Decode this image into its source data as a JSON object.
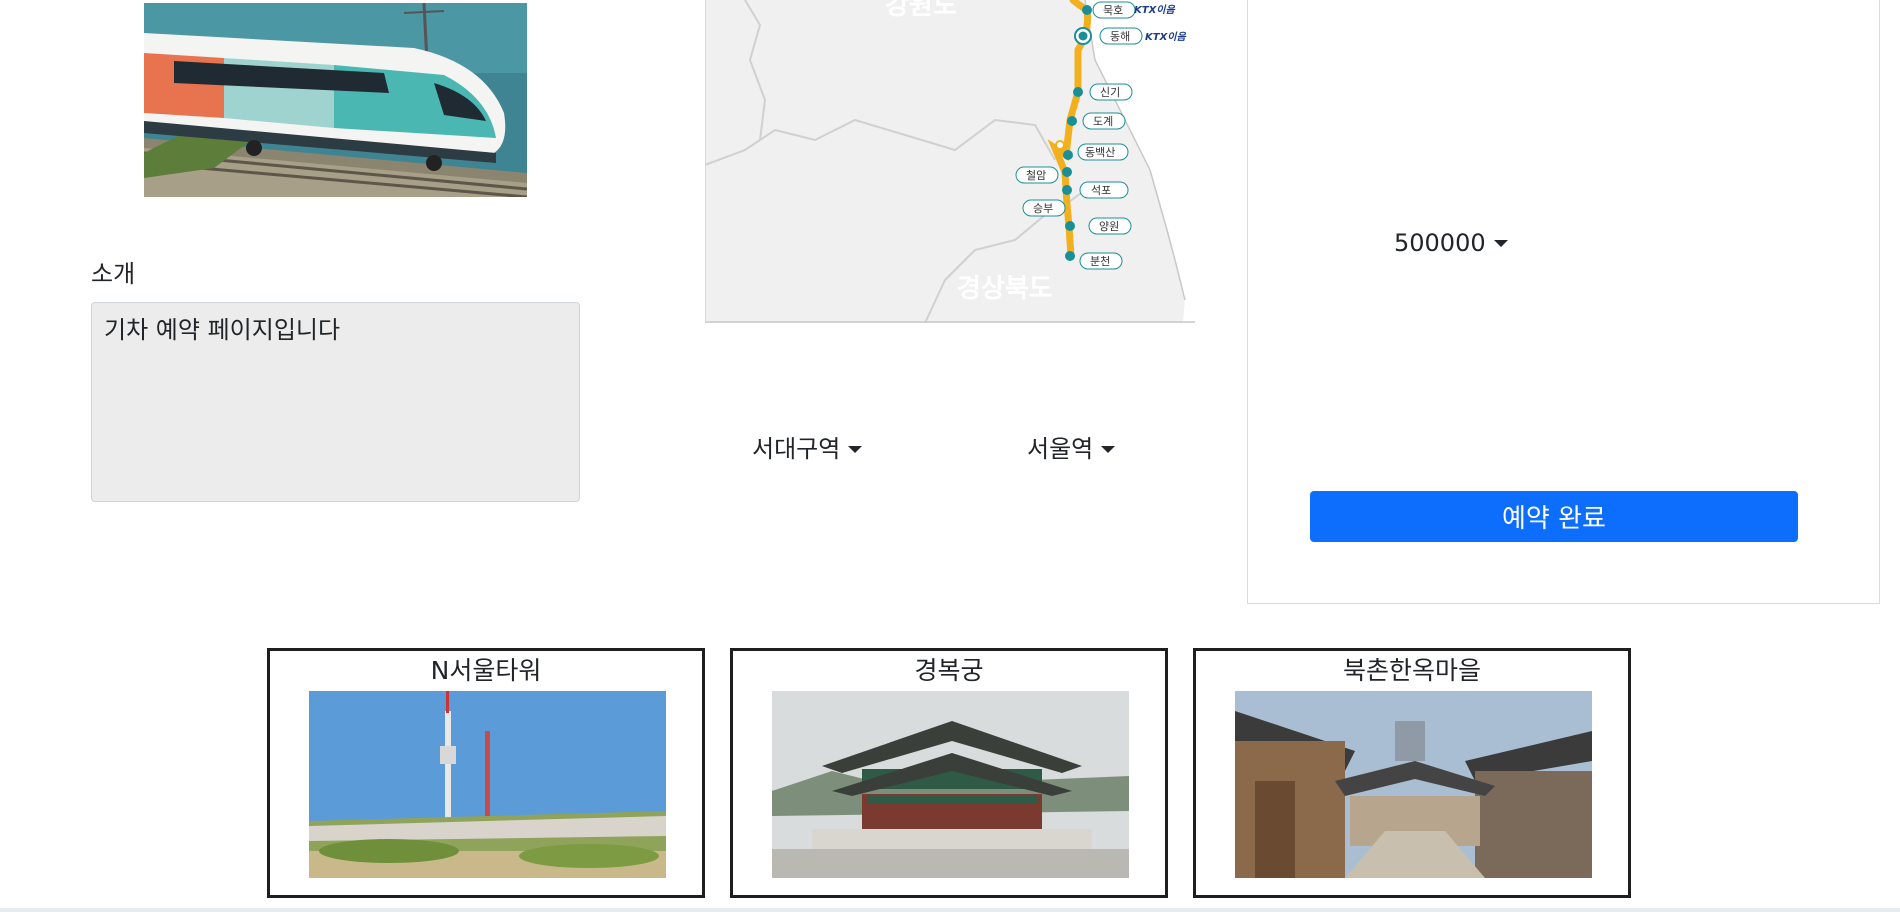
{
  "intro": {
    "label": "소개",
    "text": "기차 예약 페이지입니다"
  },
  "map": {
    "region_top": "강원도",
    "region_bottom": "경상북도",
    "badge_text": "KTX이음",
    "stations": [
      "묵호",
      "동해",
      "신기",
      "도계",
      "동백산",
      "철암",
      "석포",
      "승부",
      "양원",
      "분천"
    ]
  },
  "route": {
    "from_selected": "서대구역",
    "to_selected": "서울역"
  },
  "reservation": {
    "price_selected": "500000",
    "button_label": "예약 완료"
  },
  "attractions": [
    {
      "title": "N서울타워"
    },
    {
      "title": "경복궁"
    },
    {
      "title": "북촌한옥마을"
    }
  ],
  "colors": {
    "primary": "#0d6efd",
    "route_line": "#f2b01e",
    "station_dot": "#1a8f96",
    "map_land": "#f0f0f0"
  }
}
